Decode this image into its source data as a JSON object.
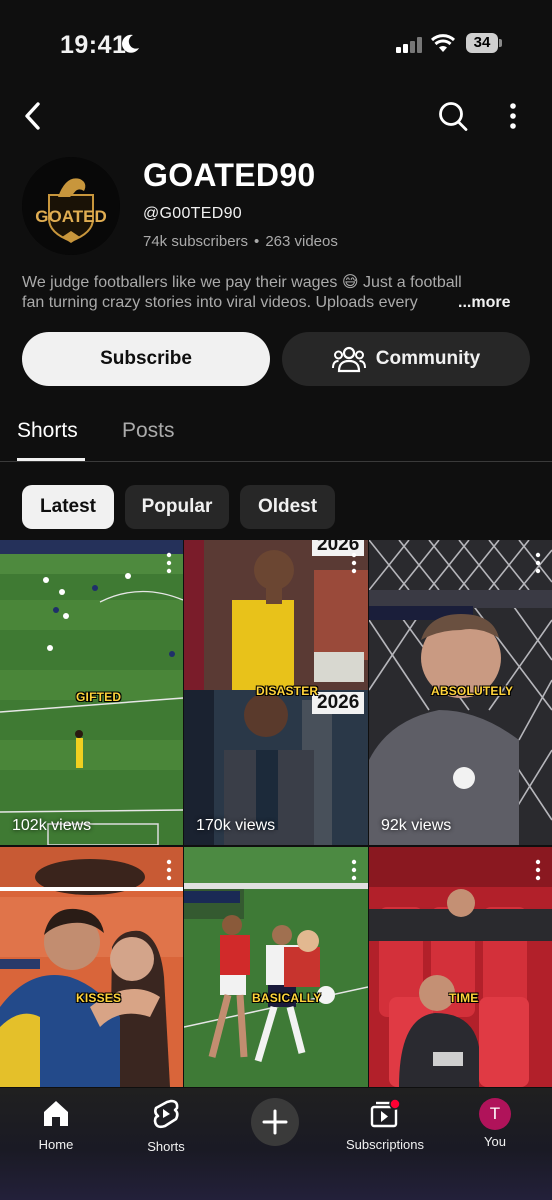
{
  "status_bar": {
    "time": "19:41",
    "battery": "34"
  },
  "channel": {
    "avatar_text": "GOATED",
    "name": "GOATED90",
    "handle": "@G00TED90",
    "subscribers": "74k subscribers",
    "separator": "•",
    "videos": "263 videos",
    "description_line1": "We judge footballers like we pay their wages 😅 Just a football",
    "description_line2": "fan turning crazy stories into viral videos. Uploads every",
    "more_label": "...more"
  },
  "actions": {
    "subscribe_label": "Subscribe",
    "community_label": "Community"
  },
  "tabs": [
    {
      "label": "Shorts"
    },
    {
      "label": "Posts"
    }
  ],
  "filters": [
    {
      "label": "Latest"
    },
    {
      "label": "Popular"
    },
    {
      "label": "Oldest"
    }
  ],
  "shorts": [
    {
      "caption": "GIFTED",
      "views": "102k views"
    },
    {
      "caption": "DISASTER",
      "overlay_text": "2026",
      "views": "170k views"
    },
    {
      "caption": "ABSOLUTELY",
      "views": "92k views"
    },
    {
      "caption": "KISSES",
      "views": ""
    },
    {
      "caption": "BASICALLY",
      "views": ""
    },
    {
      "caption": "TIME",
      "views": ""
    }
  ],
  "bottom_nav": {
    "home": "Home",
    "shorts": "Shorts",
    "subscriptions": "Subscriptions",
    "you": "You",
    "you_initial": "T"
  },
  "colors": {
    "background": "#0f0f0f",
    "accent_red": "#ff0033",
    "you_avatar": "#b0135a"
  }
}
